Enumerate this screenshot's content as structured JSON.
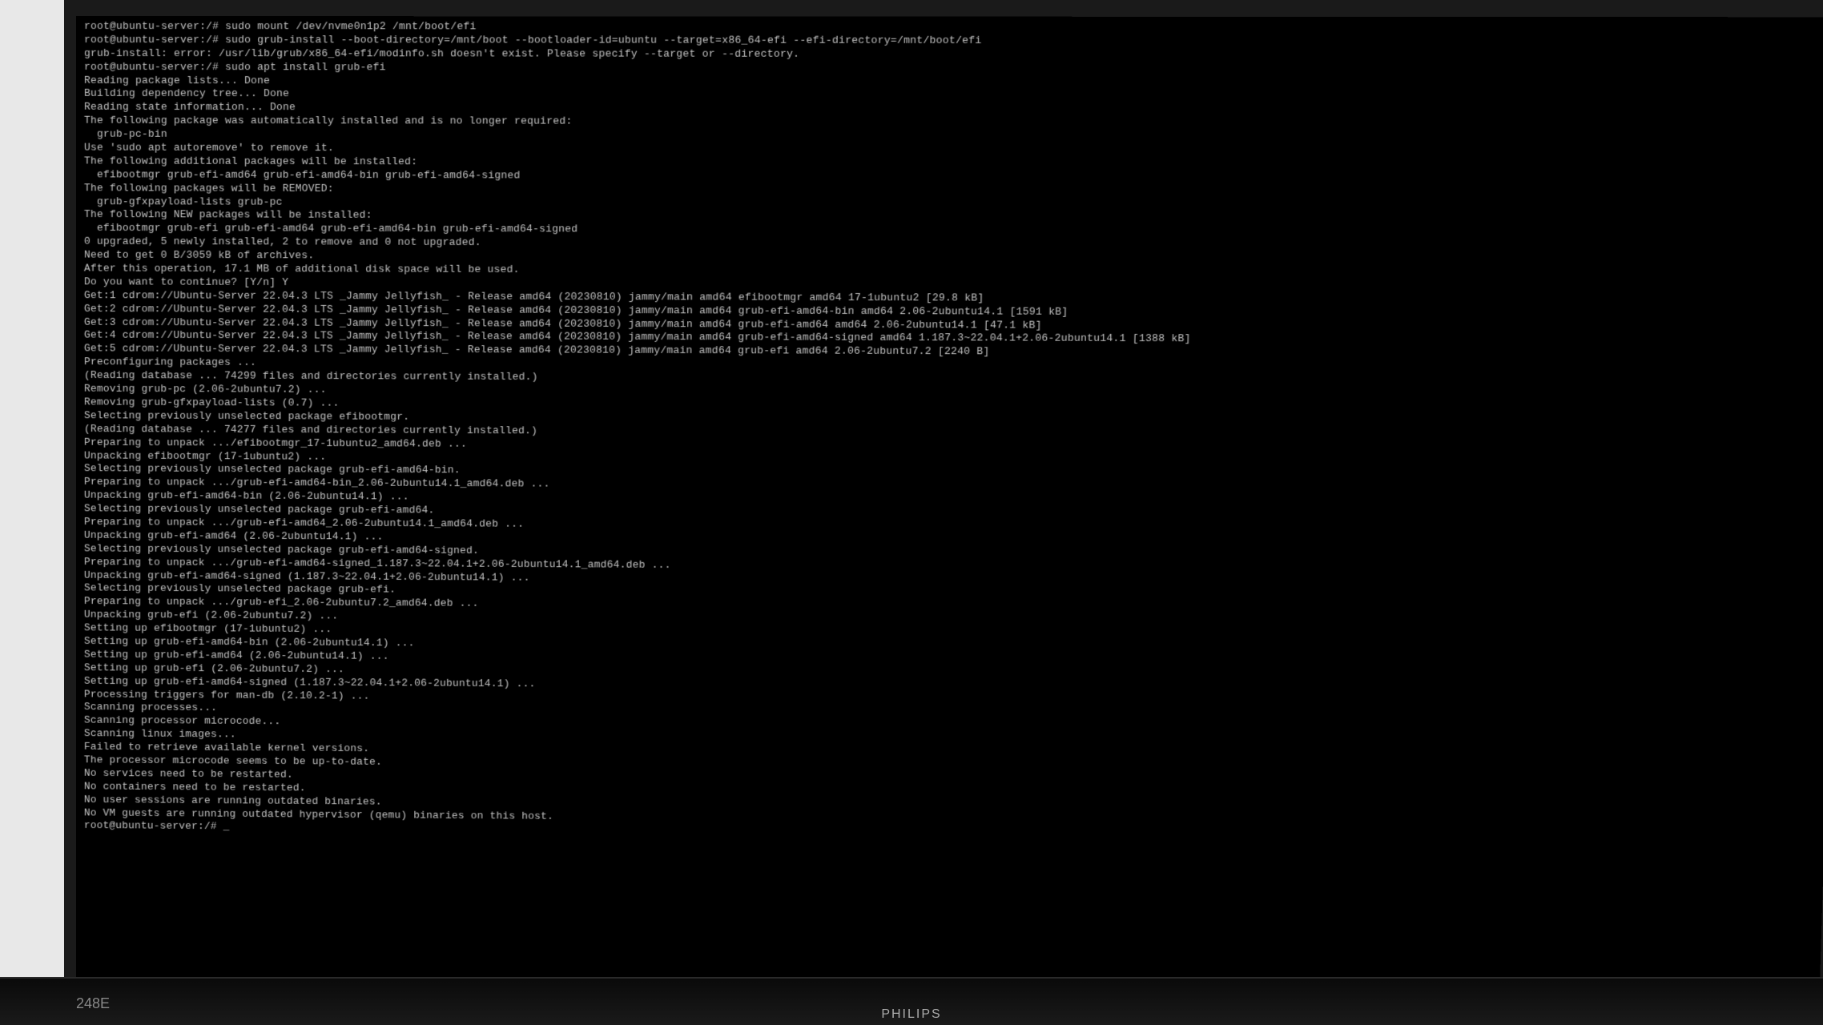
{
  "terminal": {
    "lines": [
      "root@ubuntu-server:/# sudo mount /dev/nvme0n1p2 /mnt/boot/efi",
      "root@ubuntu-server:/# sudo grub-install --boot-directory=/mnt/boot --bootloader-id=ubuntu --target=x86_64-efi --efi-directory=/mnt/boot/efi",
      "grub-install: error: /usr/lib/grub/x86_64-efi/modinfo.sh doesn't exist. Please specify --target or --directory.",
      "root@ubuntu-server:/# sudo apt install grub-efi",
      "Reading package lists... Done",
      "Building dependency tree... Done",
      "Reading state information... Done",
      "The following package was automatically installed and is no longer required:",
      "  grub-pc-bin",
      "Use 'sudo apt autoremove' to remove it.",
      "The following additional packages will be installed:",
      "  efibootmgr grub-efi-amd64 grub-efi-amd64-bin grub-efi-amd64-signed",
      "The following packages will be REMOVED:",
      "  grub-gfxpayload-lists grub-pc",
      "The following NEW packages will be installed:",
      "  efibootmgr grub-efi grub-efi-amd64 grub-efi-amd64-bin grub-efi-amd64-signed",
      "0 upgraded, 5 newly installed, 2 to remove and 0 not upgraded.",
      "Need to get 0 B/3059 kB of archives.",
      "After this operation, 17.1 MB of additional disk space will be used.",
      "Do you want to continue? [Y/n] Y",
      "Get:1 cdrom://Ubuntu-Server 22.04.3 LTS _Jammy Jellyfish_ - Release amd64 (20230810) jammy/main amd64 efibootmgr amd64 17-1ubuntu2 [29.8 kB]",
      "Get:2 cdrom://Ubuntu-Server 22.04.3 LTS _Jammy Jellyfish_ - Release amd64 (20230810) jammy/main amd64 grub-efi-amd64-bin amd64 2.06-2ubuntu14.1 [1591 kB]",
      "Get:3 cdrom://Ubuntu-Server 22.04.3 LTS _Jammy Jellyfish_ - Release amd64 (20230810) jammy/main amd64 grub-efi-amd64 amd64 2.06-2ubuntu14.1 [47.1 kB]",
      "Get:4 cdrom://Ubuntu-Server 22.04.3 LTS _Jammy Jellyfish_ - Release amd64 (20230810) jammy/main amd64 grub-efi-amd64-signed amd64 1.187.3~22.04.1+2.06-2ubuntu14.1 [1388 kB]",
      "Get:5 cdrom://Ubuntu-Server 22.04.3 LTS _Jammy Jellyfish_ - Release amd64 (20230810) jammy/main amd64 grub-efi amd64 2.06-2ubuntu7.2 [2240 B]",
      "Preconfiguring packages ...",
      "(Reading database ... 74299 files and directories currently installed.)",
      "Removing grub-pc (2.06-2ubuntu7.2) ...",
      "Removing grub-gfxpayload-lists (0.7) ...",
      "Selecting previously unselected package efibootmgr.",
      "(Reading database ... 74277 files and directories currently installed.)",
      "Preparing to unpack .../efibootmgr_17-1ubuntu2_amd64.deb ...",
      "Unpacking efibootmgr (17-1ubuntu2) ...",
      "Selecting previously unselected package grub-efi-amd64-bin.",
      "Preparing to unpack .../grub-efi-amd64-bin_2.06-2ubuntu14.1_amd64.deb ...",
      "Unpacking grub-efi-amd64-bin (2.06-2ubuntu14.1) ...",
      "Selecting previously unselected package grub-efi-amd64.",
      "Preparing to unpack .../grub-efi-amd64_2.06-2ubuntu14.1_amd64.deb ...",
      "Unpacking grub-efi-amd64 (2.06-2ubuntu14.1) ...",
      "Selecting previously unselected package grub-efi-amd64-signed.",
      "Preparing to unpack .../grub-efi-amd64-signed_1.187.3~22.04.1+2.06-2ubuntu14.1_amd64.deb ...",
      "Unpacking grub-efi-amd64-signed (1.187.3~22.04.1+2.06-2ubuntu14.1) ...",
      "Selecting previously unselected package grub-efi.",
      "Preparing to unpack .../grub-efi_2.06-2ubuntu7.2_amd64.deb ...",
      "Unpacking grub-efi (2.06-2ubuntu7.2) ...",
      "Setting up efibootmgr (17-1ubuntu2) ...",
      "Setting up grub-efi-amd64-bin (2.06-2ubuntu14.1) ...",
      "Setting up grub-efi-amd64 (2.06-2ubuntu14.1) ...",
      "Setting up grub-efi (2.06-2ubuntu7.2) ...",
      "Setting up grub-efi-amd64-signed (1.187.3~22.04.1+2.06-2ubuntu14.1) ...",
      "Processing triggers for man-db (2.10.2-1) ...",
      "Scanning processes...",
      "Scanning processor microcode...",
      "Scanning linux images...",
      "",
      "Failed to retrieve available kernel versions.",
      "",
      "The processor microcode seems to be up-to-date.",
      "",
      "No services need to be restarted.",
      "",
      "No containers need to be restarted.",
      "",
      "No user sessions are running outdated binaries.",
      "",
      "No VM guests are running outdated hypervisor (qemu) binaries on this host.",
      "root@ubuntu-server:/# "
    ],
    "prompt_cursor": "_"
  },
  "monitor": {
    "model": "248E",
    "brand": "PHILIPS"
  }
}
